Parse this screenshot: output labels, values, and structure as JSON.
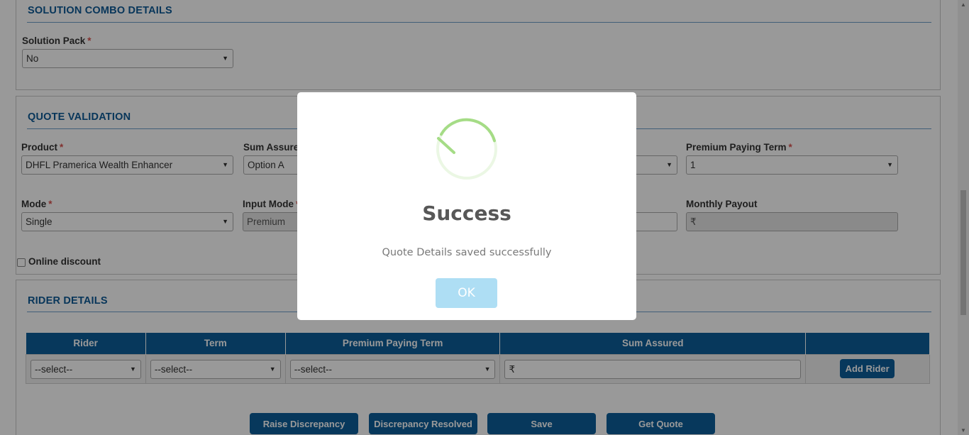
{
  "combo": {
    "title": "SOLUTION COMBO DETAILS",
    "solution_pack_label": "Solution Pack",
    "solution_pack_value": "No"
  },
  "required_mark": "*",
  "quote": {
    "title": "QUOTE VALIDATION",
    "product_label": "Product",
    "product_value": "DHFL Pramerica Wealth Enhancer",
    "sum_assured_label": "Sum Assure",
    "sum_assured_value": "Option A",
    "ppt_label": "Premium Paying Term",
    "ppt_value": "1",
    "mode_label": "Mode",
    "mode_value": "Single",
    "input_mode_label": "Input Mode",
    "input_mode_value": "Premium",
    "monthly_payout_label": "Monthly Payout",
    "monthly_payout_value": "₹",
    "online_discount_label": "Online discount"
  },
  "rider": {
    "title": "RIDER DETAILS",
    "columns": [
      "Rider",
      "Term",
      "Premium Paying Term",
      "Sum Assured",
      ""
    ],
    "select_placeholder": "--select--",
    "sum_assured_value": "₹",
    "add_label": "Add Rider"
  },
  "actions": {
    "raise": "Raise Discrepancy",
    "resolved": "Discrepancy Resolved",
    "save": "Save",
    "get_quote": "Get Quote"
  },
  "modal": {
    "title": "Success",
    "text": "Quote Details saved successfully",
    "ok": "OK",
    "accent_color": "#a5dc86",
    "button_color": "#aedef4"
  },
  "icons": {
    "caret": "chevron-down-icon",
    "success": "success-check-icon"
  }
}
